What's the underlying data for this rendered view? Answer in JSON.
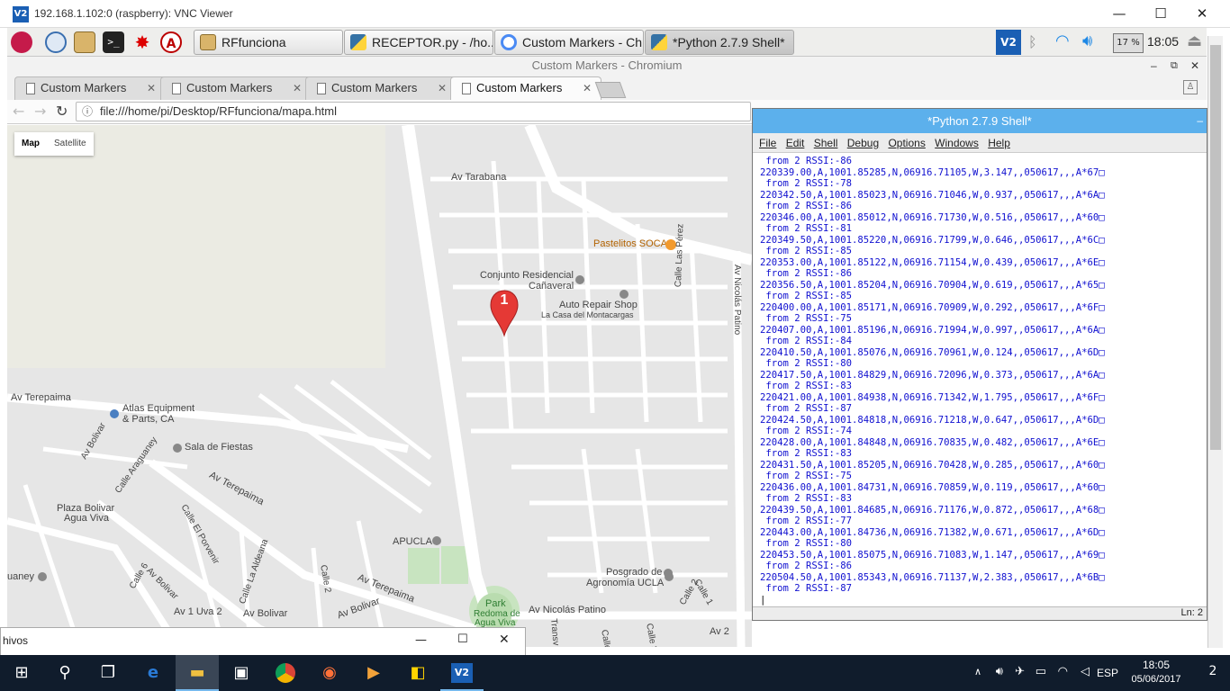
{
  "vnc": {
    "title": "192.168.1.102:0 (raspberry): VNC Viewer",
    "min": "—",
    "max": "☐",
    "close": "✕"
  },
  "pi_taskbar": {
    "tasks": [
      {
        "label": "RFfunciona"
      },
      {
        "label": "RECEPTOR.py - /ho..."
      },
      {
        "label": "Custom Markers - Ch..."
      },
      {
        "label": "*Python 2.7.9 Shell*"
      }
    ],
    "cpu": "17 %",
    "clock": "18:05"
  },
  "chromium": {
    "window_title": "Custom Markers - Chromium",
    "tabs": [
      {
        "label": "Custom Markers"
      },
      {
        "label": "Custom Markers"
      },
      {
        "label": "Custom Markers"
      },
      {
        "label": "Custom Markers"
      }
    ],
    "url": "file:///home/pi/Desktop/RFfunciona/mapa.html"
  },
  "map": {
    "type_map": "Map",
    "type_satellite": "Satellite",
    "marker_label": "1",
    "labels": {
      "av_tarabana": "Av Tarabana",
      "pastelitos": "Pastelitos SOCA",
      "conjunto": "Conjunto Residencial",
      "canaveral": "Cañaveral",
      "auto_repair": "Auto Repair Shop",
      "casa_montacargas": "La Casa del Montacargas",
      "calle_las_perez": "Calle Las Pérez",
      "av_nicolas_patino_v": "Av Nicolás Patino",
      "av_terepaima_1": "Av Terepaima",
      "atlas": "Atlas Equipment",
      "atlas2": "& Parts, CA",
      "sala_fiestas": "Sala de Fiestas",
      "av_bolivar_1": "Av Bolivar",
      "calle_araguaney": "Calle Araguaney",
      "av_terepaima_2": "Av Terepaima",
      "plaza_bolivar": "Plaza Bolivar",
      "agua_viva": "Agua Viva",
      "calle_el_porvenir": "Calle El Porvenir",
      "apucla": "APUCLA",
      "calle_la_aldeana": "Calle La Aldeana",
      "araguaney": "uaney",
      "calle_6": "Calle 6",
      "av_bolivar_2": "Av Bolivar",
      "calle_2": "Calle 2",
      "av_terepaima_3": "Av Terepaima",
      "av_bolivar_3": "Av Bolivar",
      "av_bolivar_4": "Av Bolivar",
      "av_1_uva_2": "Av 1 Uva 2",
      "park": "Park",
      "redoma": "Redoma de",
      "agua_viva_park": "Agua Viva",
      "av_nicolas_patino_h": "Av Nicolás Patino",
      "posgrado": "Posgrado de",
      "agronomia": "Agronomía UCLA",
      "calle_1": "Calle 1",
      "calle_2b": "Calle 2",
      "calle_4": "Calle 4",
      "calle_3": "Calle 3",
      "transv": "Transv",
      "av_2": "Av 2"
    }
  },
  "python_shell": {
    "title": "*Python 2.7.9 Shell*",
    "menu": [
      "File",
      "Edit",
      "Shell",
      "Debug",
      "Options",
      "Windows",
      "Help"
    ],
    "lines": [
      " from 2 RSSI:-86",
      "220339.00,A,1001.85285,N,06916.71105,W,3.147,,050617,,,A*67□",
      " from 2 RSSI:-78",
      "220342.50,A,1001.85023,N,06916.71046,W,0.937,,050617,,,A*6A□",
      " from 2 RSSI:-86",
      "220346.00,A,1001.85012,N,06916.71730,W,0.516,,050617,,,A*60□",
      " from 2 RSSI:-81",
      "220349.50,A,1001.85220,N,06916.71799,W,0.646,,050617,,,A*6C□",
      " from 2 RSSI:-85",
      "220353.00,A,1001.85122,N,06916.71154,W,0.439,,050617,,,A*6E□",
      " from 2 RSSI:-86",
      "220356.50,A,1001.85204,N,06916.70904,W,0.619,,050617,,,A*65□",
      " from 2 RSSI:-85",
      "220400.00,A,1001.85171,N,06916.70909,W,0.292,,050617,,,A*6F□",
      " from 2 RSSI:-75",
      "220407.00,A,1001.85196,N,06916.71994,W,0.997,,050617,,,A*6A□",
      " from 2 RSSI:-84",
      "220410.50,A,1001.85076,N,06916.70961,W,0.124,,050617,,,A*6D□",
      " from 2 RSSI:-80",
      "220417.50,A,1001.84829,N,06916.72096,W,0.373,,050617,,,A*6A□",
      " from 2 RSSI:-83",
      "220421.00,A,1001.84938,N,06916.71342,W,1.795,,050617,,,A*6F□",
      " from 2 RSSI:-87",
      "220424.50,A,1001.84818,N,06916.71218,W,0.647,,050617,,,A*6D□",
      " from 2 RSSI:-74",
      "220428.00,A,1001.84848,N,06916.70835,W,0.482,,050617,,,A*6E□",
      " from 2 RSSI:-83",
      "220431.50,A,1001.85205,N,06916.70428,W,0.285,,050617,,,A*60□",
      " from 2 RSSI:-75",
      "220436.00,A,1001.84731,N,06916.70859,W,0.119,,050617,,,A*60□",
      " from 2 RSSI:-83",
      "220439.50,A,1001.84685,N,06916.71176,W,0.872,,050617,,,A*68□",
      " from 2 RSSI:-77",
      "220443.00,A,1001.84736,N,06916.71382,W,0.671,,050617,,,A*6D□",
      " from 2 RSSI:-80",
      "220453.50,A,1001.85075,N,06916.71083,W,1.147,,050617,,,A*69□",
      " from 2 RSSI:-86",
      "220504.50,A,1001.85343,N,06916.71137,W,2.383,,050617,,,A*6B□",
      " from 2 RSSI:-87",
      "|"
    ],
    "status": "Ln: 2"
  },
  "explorer": {
    "title": "hivos",
    "min": "—",
    "max": "☐",
    "close": "✕"
  },
  "win_taskbar": {
    "lang": "ESP",
    "time": "18:05",
    "date": "05/06/2017",
    "notif": "2"
  },
  "colors": {
    "py_title": "#5cb0ec",
    "py_text": "#1010d0",
    "map_bg": "#e6e6e6",
    "road": "#ffffff",
    "marker": "#e53935",
    "win_taskbar": "#101c2c"
  }
}
